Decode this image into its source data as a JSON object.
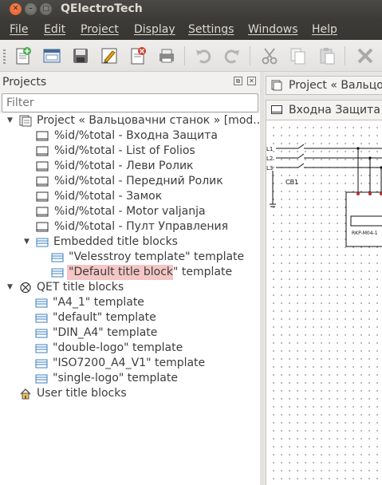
{
  "window": {
    "title": "QElectroTech"
  },
  "menubar": [
    "File",
    "Edit",
    "Project",
    "Display",
    "Settings",
    "Windows",
    "Help"
  ],
  "toolbar": {
    "icons": [
      "new-project-icon",
      "open-project-icon",
      "save-icon",
      "save-as-icon",
      "close-project-icon",
      "print-icon",
      "undo-icon",
      "redo-icon",
      "cut-icon",
      "copy-icon",
      "paste-icon",
      "delete-icon"
    ]
  },
  "projects_panel": {
    "title": "Projects",
    "filter_placeholder": "Filter",
    "tree": [
      {
        "label": "Project « Вальцовачни станок » [mod...",
        "icon": "project-icon",
        "expanded": true
      },
      {
        "label": "%id/%total - Входна Защита",
        "icon": "folio-icon"
      },
      {
        "label": "%id/%total - List of Folios",
        "icon": "folio-icon"
      },
      {
        "label": "%id/%total - Леви Ролик",
        "icon": "folio-icon"
      },
      {
        "label": "%id/%total - Передний Ролик",
        "icon": "folio-icon"
      },
      {
        "label": "%id/%total - Замок",
        "icon": "folio-icon"
      },
      {
        "label": "%id/%total - Motor valjanja",
        "icon": "folio-icon"
      },
      {
        "label": "%id/%total - Пулт Управления",
        "icon": "folio-icon"
      },
      {
        "label": "Embedded title blocks",
        "icon": "titleblock-icon",
        "expanded": true
      },
      {
        "label": "\"Velesstroy template\" template",
        "icon": "titleblock-icon"
      },
      {
        "label": "\"Default title block\" template",
        "icon": "titleblock-icon",
        "selected": true
      },
      {
        "label": "QET title blocks",
        "icon": "qet-logo-icon",
        "expanded": true
      },
      {
        "label": "\"A4_1\" template",
        "icon": "titleblock-icon"
      },
      {
        "label": "\"default\" template",
        "icon": "titleblock-icon"
      },
      {
        "label": "\"DIN_A4\" template",
        "icon": "titleblock-icon"
      },
      {
        "label": "\"double-logo\" template",
        "icon": "titleblock-icon"
      },
      {
        "label": "\"ISO7200_A4_V1\" template",
        "icon": "titleblock-icon"
      },
      {
        "label": "\"single-logo\" template",
        "icon": "titleblock-icon"
      },
      {
        "label": "User title blocks",
        "icon": "home-icon"
      }
    ]
  },
  "workspace": {
    "project_tab": "Project « Вальцовачни станок »",
    "folio_tab": "Входна Защита",
    "schematic_labels": {
      "l1": "L1",
      "l2": "L2",
      "l3": "L3",
      "cb": "CB1",
      "block": "RKP-M04-1"
    }
  },
  "colors": {
    "selection": "#f5c6c6",
    "titlebar": "#3c3b37",
    "close_button": "#e2541a"
  }
}
